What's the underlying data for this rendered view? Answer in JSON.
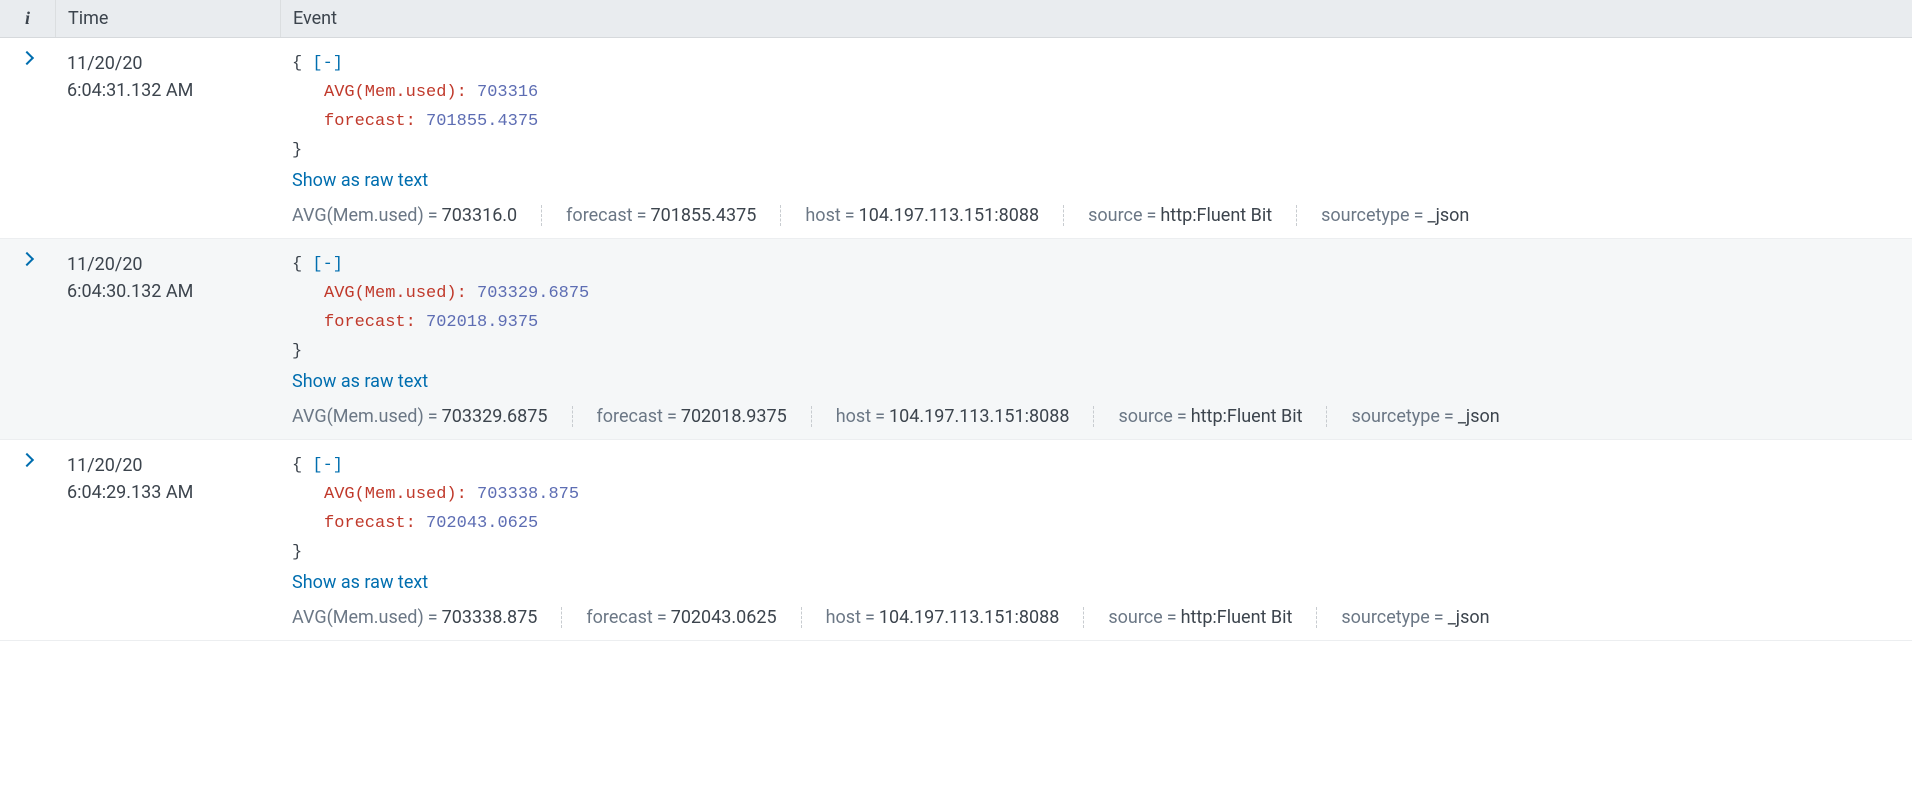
{
  "header": {
    "info_icon": "i",
    "time_label": "Time",
    "event_label": "Event"
  },
  "json_ui": {
    "open_brace": "{",
    "close_brace": "}",
    "collapse_token": "[-]",
    "raw_link": "Show as raw text",
    "colon": ":"
  },
  "field_eq": "=",
  "events": [
    {
      "date": "11/20/20",
      "time": "6:04:31.132 AM",
      "json": [
        {
          "key": "AVG(Mem.used)",
          "value": "703316"
        },
        {
          "key": "forecast",
          "value": "701855.4375"
        }
      ],
      "fields": [
        {
          "key": "AVG(Mem.used)",
          "value": "703316.0"
        },
        {
          "key": "forecast",
          "value": "701855.4375"
        },
        {
          "key": "host",
          "value": "104.197.113.151:8088"
        },
        {
          "key": "source",
          "value": "http:Fluent Bit"
        },
        {
          "key": "sourcetype",
          "value": "_json"
        }
      ]
    },
    {
      "date": "11/20/20",
      "time": "6:04:30.132 AM",
      "json": [
        {
          "key": "AVG(Mem.used)",
          "value": "703329.6875"
        },
        {
          "key": "forecast",
          "value": "702018.9375"
        }
      ],
      "fields": [
        {
          "key": "AVG(Mem.used)",
          "value": "703329.6875"
        },
        {
          "key": "forecast",
          "value": "702018.9375"
        },
        {
          "key": "host",
          "value": "104.197.113.151:8088"
        },
        {
          "key": "source",
          "value": "http:Fluent Bit"
        },
        {
          "key": "sourcetype",
          "value": "_json"
        }
      ]
    },
    {
      "date": "11/20/20",
      "time": "6:04:29.133 AM",
      "json": [
        {
          "key": "AVG(Mem.used)",
          "value": "703338.875"
        },
        {
          "key": "forecast",
          "value": "702043.0625"
        }
      ],
      "fields": [
        {
          "key": "AVG(Mem.used)",
          "value": "703338.875"
        },
        {
          "key": "forecast",
          "value": "702043.0625"
        },
        {
          "key": "host",
          "value": "104.197.113.151:8088"
        },
        {
          "key": "source",
          "value": "http:Fluent Bit"
        },
        {
          "key": "sourcetype",
          "value": "_json"
        }
      ]
    }
  ]
}
